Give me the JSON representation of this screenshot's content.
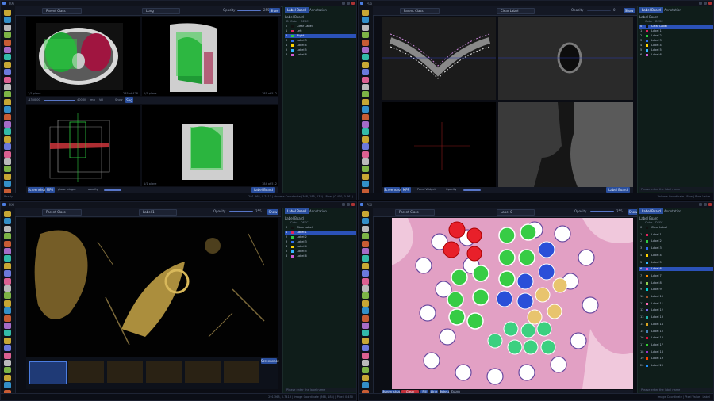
{
  "top_left": {
    "window_title": "PiXi",
    "dropdown_left": "Parent Class",
    "dropdown_label": "Lung",
    "opacity_label": "Opacity",
    "opacity_value": "255",
    "view_button": "Show",
    "tabs": [
      "Label Board",
      "Annotation"
    ],
    "panel_title": "Label Board",
    "columns": [
      "ID",
      "Color",
      "DESC"
    ],
    "labels": [
      {
        "id": "0",
        "name": "Clear Label",
        "color": "#111111"
      },
      {
        "id": "1",
        "name": "Left",
        "color": "#e0245e"
      },
      {
        "id": "2",
        "name": "Right",
        "color": "#2ecc40",
        "selected": true
      },
      {
        "id": "3",
        "name": "Label 3",
        "color": "#2f6ef0"
      },
      {
        "id": "4",
        "name": "Label 4",
        "color": "#ffd400"
      },
      {
        "id": "5",
        "name": "Label 5",
        "color": "#34b6ff"
      },
      {
        "id": "6",
        "name": "Label 6",
        "color": "#d35bd3"
      }
    ],
    "view_labels": [
      "1/1 plane",
      "235 of 428",
      "1/1 plane",
      "185 of 512",
      "1/1 plane",
      "184 of 512"
    ],
    "mid_bar": [
      "-1350.00",
      "400.00",
      "Img",
      "Vol",
      "Show",
      "Seg"
    ],
    "bottom_bar": [
      "Screenshot",
      "MPR",
      "plane widget",
      "opacity"
    ],
    "bottom_btn": "Label Board",
    "status_left": "Ready",
    "status_right": "291 368, 0.7413 | Volume Coordinate (368, 185, 133) | Raw: (0.450, 0.461)"
  },
  "top_right": {
    "dropdown_left": "Parent Class",
    "dropdown_label": "Clear Label",
    "opacity_label": "Opacity",
    "opacity_value": "0",
    "view_button": "Show",
    "tabs": [
      "Label Board",
      "Annotation"
    ],
    "panel_title": "Label Board",
    "columns": [
      "Color",
      "DESC"
    ],
    "labels": [
      {
        "id": "0",
        "name": "Clear Label",
        "color": "#111111",
        "selected": true
      },
      {
        "id": "1",
        "name": "Label 1",
        "color": "#e0245e"
      },
      {
        "id": "2",
        "name": "Label 2",
        "color": "#2ecc40"
      },
      {
        "id": "3",
        "name": "Label 3",
        "color": "#2f6ef0"
      },
      {
        "id": "4",
        "name": "Label 4",
        "color": "#ffd400"
      },
      {
        "id": "5",
        "name": "Label 5",
        "color": "#34b6ff"
      },
      {
        "id": "6",
        "name": "Label 6",
        "color": "#d35bd3"
      }
    ],
    "bottom_bar": [
      "Screenshot",
      "MPR",
      "Panel Widget",
      "Opacity"
    ],
    "bottom_btn": "Label Board",
    "search": "Please enter the label name",
    "status_right": "Volume Coordinate | Raw | Pixel Value"
  },
  "bottom_left": {
    "dropdown_left": "Parent Class",
    "dropdown_label": "Label 1",
    "opacity_label": "Opacity",
    "opacity_value": "255",
    "view_button": "Show",
    "tabs": [
      "Label Board",
      "Annotation"
    ],
    "panel_title": "Label Board",
    "columns": [
      "Color",
      "DESC"
    ],
    "labels": [
      {
        "id": "0",
        "name": "Clear Label",
        "color": "#111111"
      },
      {
        "id": "1",
        "name": "Label 1",
        "color": "#e0245e",
        "selected": true
      },
      {
        "id": "2",
        "name": "Label 2",
        "color": "#2ecc40"
      },
      {
        "id": "3",
        "name": "Label 3",
        "color": "#2f6ef0"
      },
      {
        "id": "4",
        "name": "Label 4",
        "color": "#ffd400"
      },
      {
        "id": "5",
        "name": "Label 5",
        "color": "#34b6ff"
      },
      {
        "id": "6",
        "name": "Label 6",
        "color": "#d35bd3"
      }
    ],
    "thumb_btn": "Screenshot",
    "search": "Please enter the label name",
    "status_right": "291 368, 0.7413 | Image Coordinate (368, 185) | Pixel: 0.450"
  },
  "bottom_right": {
    "dropdown_left": "Parent Class",
    "dropdown_label": "Label 0",
    "opacity_label": "Opacity",
    "opacity_value": "255",
    "view_button": "Show",
    "tabs": [
      "Label Board",
      "Annotation"
    ],
    "panel_title": "Label Board",
    "columns": [
      "Color",
      "DESC"
    ],
    "labels": [
      {
        "id": "0",
        "name": "Clear Label",
        "color": "#111111"
      },
      {
        "id": "1",
        "name": "Label 1",
        "color": "#e0245e"
      },
      {
        "id": "2",
        "name": "Label 2",
        "color": "#2ecc40"
      },
      {
        "id": "3",
        "name": "Label 3",
        "color": "#2f6ef0"
      },
      {
        "id": "4",
        "name": "Label 4",
        "color": "#ffd400"
      },
      {
        "id": "5",
        "name": "Label 5",
        "color": "#34b6ff"
      },
      {
        "id": "6",
        "name": "Label 6",
        "color": "#d35bd3",
        "selected": true
      },
      {
        "id": "7",
        "name": "Label 7",
        "color": "#ff8c00"
      },
      {
        "id": "8",
        "name": "Label 8",
        "color": "#8fd14f"
      },
      {
        "id": "9",
        "name": "Label 9",
        "color": "#00ced1"
      },
      {
        "id": "10",
        "name": "Label 10",
        "color": "#a0522d"
      },
      {
        "id": "11",
        "name": "Label 11",
        "color": "#ff69b4"
      },
      {
        "id": "12",
        "name": "Label 12",
        "color": "#7b68ee"
      },
      {
        "id": "13",
        "name": "Label 13",
        "color": "#20b2aa"
      },
      {
        "id": "14",
        "name": "Label 14",
        "color": "#daa520"
      },
      {
        "id": "15",
        "name": "Label 15",
        "color": "#4682b4"
      },
      {
        "id": "16",
        "name": "Label 16",
        "color": "#dc143c"
      },
      {
        "id": "17",
        "name": "Label 17",
        "color": "#32cd32"
      },
      {
        "id": "18",
        "name": "Label 18",
        "color": "#9932cc"
      },
      {
        "id": "19",
        "name": "Label 19",
        "color": "#ff4500"
      },
      {
        "id": "20",
        "name": "Label 20",
        "color": "#1e90ff"
      }
    ],
    "bottom_bar": [
      "Screenshot",
      "Clear Label",
      "Fill",
      "Line",
      "Select",
      "Zoom"
    ],
    "search": "Please enter the label name",
    "status_right": "Image Coordinate | Pixel Value | Label"
  }
}
